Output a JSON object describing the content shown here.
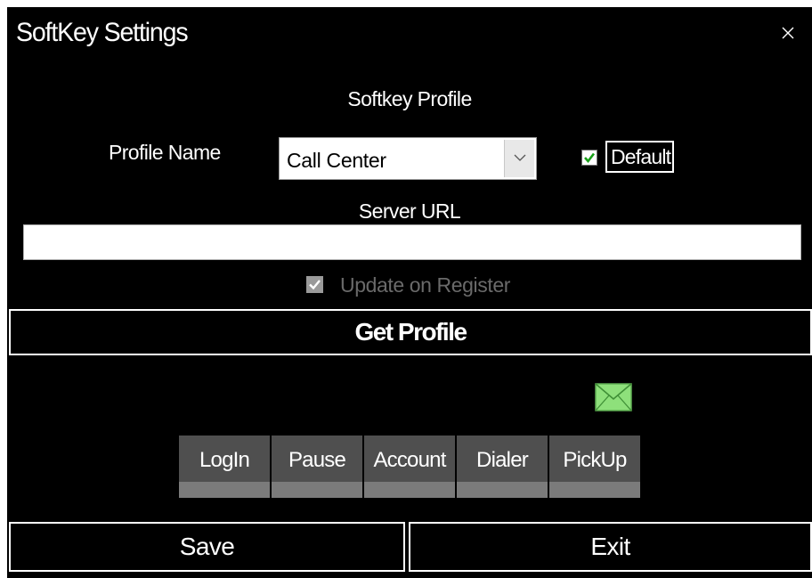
{
  "window": {
    "title": "SoftKey Settings",
    "close_icon": "close-icon"
  },
  "profile": {
    "section_title": "Softkey Profile",
    "name_label": "Profile Name",
    "selected": "Call Center",
    "dropdown_icon": "chevron-down-icon",
    "default_checked": true,
    "default_label": "Default"
  },
  "server": {
    "url_label": "Server URL",
    "url_value": "",
    "update_on_register_label": "Update on Register",
    "update_on_register_checked": true,
    "update_on_register_enabled": false
  },
  "actions": {
    "get_profile_label": "Get Profile",
    "save_label": "Save",
    "exit_label": "Exit"
  },
  "message_icon": "envelope-icon",
  "softkeys": [
    {
      "label": "LogIn"
    },
    {
      "label": "Pause"
    },
    {
      "label": "Account"
    },
    {
      "label": "Dialer"
    },
    {
      "label": "PickUp"
    }
  ],
  "colors": {
    "background": "#000000",
    "text": "#ffffff",
    "softkey_button": "#4f4f4f",
    "softkey_bar": "#7b7b7b",
    "checkmark": "#19a119",
    "envelope": "#8ee07b",
    "disabled_text": "#6a6a6a"
  }
}
